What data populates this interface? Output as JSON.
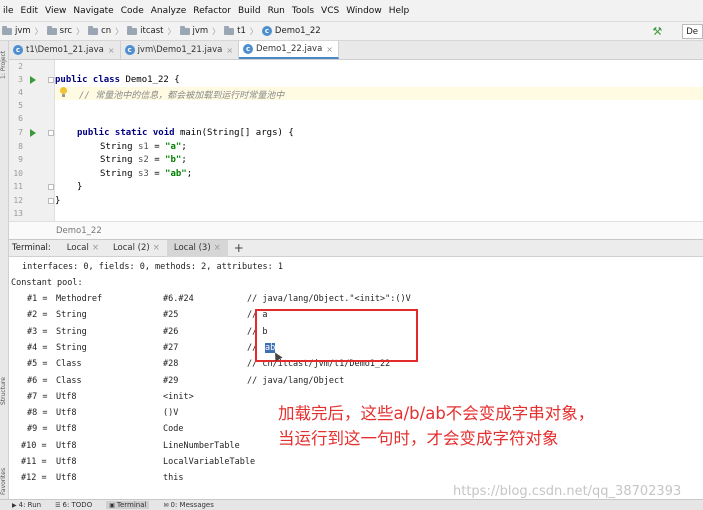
{
  "menu": [
    "ile",
    "Edit",
    "View",
    "Navigate",
    "Code",
    "Analyze",
    "Refactor",
    "Build",
    "Run",
    "Tools",
    "VCS",
    "Window",
    "Help"
  ],
  "breadcrumbs": [
    "jvm",
    "src",
    "cn",
    "itcast",
    "jvm",
    "t1",
    "Demo1_22"
  ],
  "run_config": "De",
  "left_stripe": [
    "1: Project",
    "Structure",
    "Favorites"
  ],
  "tabs": [
    {
      "label": "t1\\Demo1_21.java"
    },
    {
      "label": "jvm\\Demo1_21.java"
    },
    {
      "label": "Demo1_22.java"
    }
  ],
  "code_lines": {
    "l2": "2",
    "l3": "3",
    "l4": "4",
    "l5": "5",
    "l6": "6",
    "l7": "7",
    "l8": "8",
    "l9": "9",
    "l10": "10",
    "l11": "11",
    "l12": "12",
    "l13": "13",
    "class_decl_kw": "public class ",
    "class_decl_name": "Demo1_22 {",
    "comment": "// 常量池中的信息，都会被加载到运行时常量池中",
    "main_kw": "public static void ",
    "main_rest": "main(String[] args) {",
    "s1_type": "String ",
    "s1_var": "s1",
    "s1_eq": " = ",
    "s1_val": "\"a\"",
    "semi": ";",
    "s2_var": "s2",
    "s2_val": "\"b\"",
    "s3_var": "s3",
    "s3_val": "\"ab\"",
    "close_inner": "}",
    "close_outer": "}"
  },
  "editor_breadcrumb": "Demo1_22",
  "terminal": {
    "label": "Terminal:",
    "tabs": [
      "Local",
      "Local (2)",
      "Local (3)"
    ],
    "plus": "+",
    "header_line": "interfaces: 0, fields: 0, methods: 2, attributes: 1",
    "pool_title": "Constant pool:",
    "rows": [
      {
        "id": "#1 =",
        "kind": "Methodref",
        "ref": "#6.#24",
        "comment": "// java/lang/Object.\"<init>\":()V"
      },
      {
        "id": "#2 =",
        "kind": "String",
        "ref": "#25",
        "comment": "// a"
      },
      {
        "id": "#3 =",
        "kind": "String",
        "ref": "#26",
        "comment": "// b"
      },
      {
        "id": "#4 =",
        "kind": "String",
        "ref": "#27",
        "comment_prefix": "// ",
        "comment_sel": "ab"
      },
      {
        "id": "#5 =",
        "kind": "Class",
        "ref": "#28",
        "comment": "// cn/itcast/jvm/t1/Demo1_22"
      },
      {
        "id": "#6 =",
        "kind": "Class",
        "ref": "#29",
        "comment": "// java/lang/Object"
      },
      {
        "id": "#7 =",
        "kind": "Utf8",
        "ref": "<init>"
      },
      {
        "id": "#8 =",
        "kind": "Utf8",
        "ref": "()V"
      },
      {
        "id": "#9 =",
        "kind": "Utf8",
        "ref": "Code"
      },
      {
        "id": "#10 =",
        "kind": "Utf8",
        "ref": "LineNumberTable"
      },
      {
        "id": "#11 =",
        "kind": "Utf8",
        "ref": "LocalVariableTable"
      },
      {
        "id": "#12 =",
        "kind": "Utf8",
        "ref": "this"
      }
    ]
  },
  "annotation": {
    "line1": "加载完后，这些a/b/ab不会变成字串对象，",
    "line2": "当运行到这一句时，才会变成字符对象"
  },
  "watermark": "https://blog.csdn.net/qq_38702393",
  "statusbar": [
    "4: Run",
    "6: TODO",
    "Terminal",
    "0: Messages"
  ]
}
